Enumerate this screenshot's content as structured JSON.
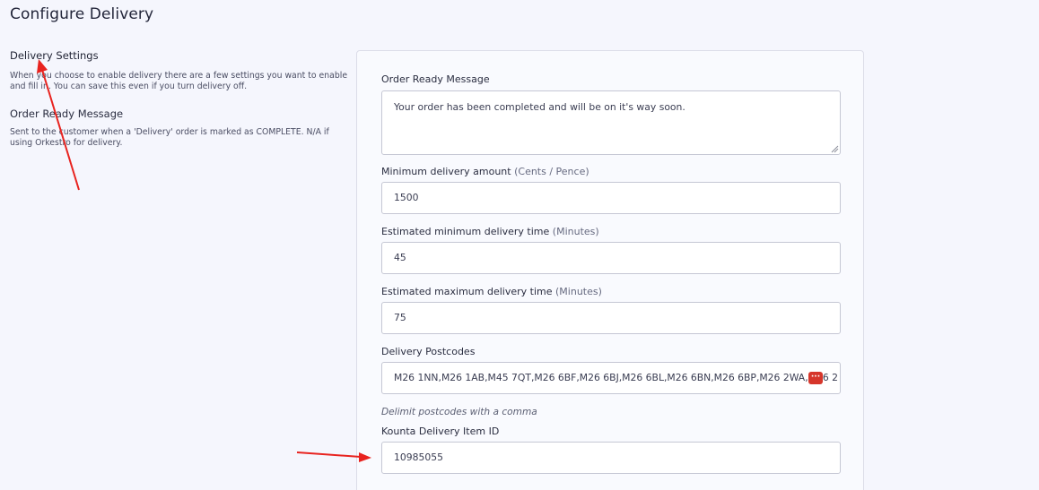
{
  "page": {
    "title": "Configure Delivery"
  },
  "left": {
    "section_heading": "Delivery Settings",
    "section_desc": "When you choose to enable delivery there are a few settings you want to enable and fill in. You can save this even if you turn delivery off.",
    "order_ready_heading": "Order Ready Message",
    "order_ready_desc": "Sent to the customer when a 'Delivery' order is marked as COMPLETE. N/A if using Orkestro for delivery."
  },
  "form": {
    "order_ready": {
      "label": "Order Ready Message",
      "value": "Your order has been completed and will be on it's way soon."
    },
    "min_amount": {
      "label": "Minimum delivery amount",
      "hint": "(Cents / Pence)",
      "value": "1500"
    },
    "min_time": {
      "label": "Estimated minimum delivery time",
      "hint": "(Minutes)",
      "value": "45"
    },
    "max_time": {
      "label": "Estimated maximum delivery time",
      "hint": "(Minutes)",
      "value": "75"
    },
    "postcodes": {
      "label": "Delivery Postcodes",
      "value": "M26 1NN,M26 1AB,M45 7QT,M26 6BF,M26 6BJ,M26 6BL,M26 6BN,M26 6BP,M26 2WA,M26 2",
      "help": "Delimit postcodes with a comma",
      "badge": "···"
    },
    "kounta_item": {
      "label": "Kounta Delivery Item ID",
      "value": "10985055"
    }
  },
  "colors": {
    "annotation_arrow": "#e8231f",
    "badge": "#d6362b"
  }
}
